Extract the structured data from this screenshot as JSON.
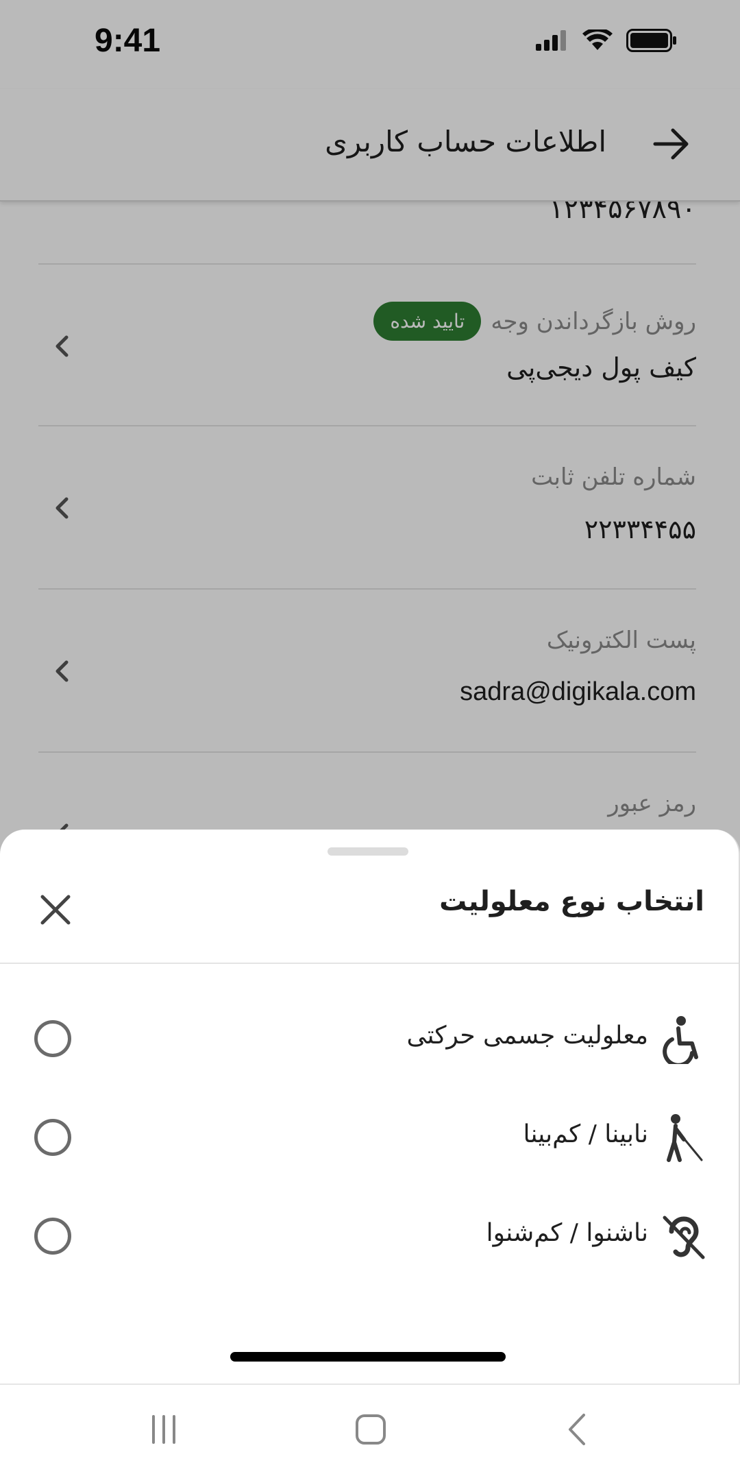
{
  "status_bar": {
    "time": "9:41"
  },
  "app_bar": {
    "title": "اطلاعات حساب کاربری"
  },
  "list": {
    "top_value": "۱۲۳۴۵۶۷۸۹۰",
    "rows": [
      {
        "label": "روش بازگرداندن وجه",
        "badge": "تایید شده",
        "value": "کیف پول دیجی‌پی"
      },
      {
        "label": "شماره تلفن ثابت",
        "value": "۲۲۳۳۴۴۵۵"
      },
      {
        "label": "پست الکترونیک",
        "value": "sadra@digikala.com"
      },
      {
        "label": "رمز عبور"
      }
    ]
  },
  "sheet": {
    "title": "انتخاب نوع معلولیت",
    "options": [
      {
        "label": "معلولیت جسمی حرکتی",
        "icon": "wheelchair-icon",
        "selected": false
      },
      {
        "label": "نابینا / کم‌بینا",
        "icon": "blind-person-icon",
        "selected": false
      },
      {
        "label": "ناشنوا / کم‌شنوا",
        "icon": "hearing-disabled-icon",
        "selected": false
      }
    ]
  },
  "nav_bar": {
    "icons": [
      "recent-apps-icon",
      "home-icon",
      "back-icon"
    ]
  },
  "colors": {
    "badge": "#2e7d32",
    "scrim": "rgba(0,0,0,0.27)",
    "text_primary": "#1f1f1f",
    "text_secondary": "#8a8a8a"
  }
}
